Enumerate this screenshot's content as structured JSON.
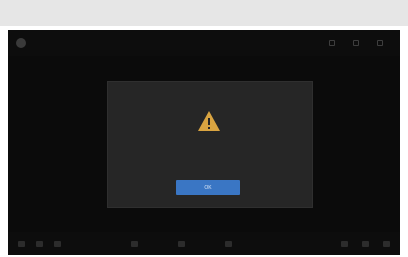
{
  "app": {
    "title": "",
    "top_actions": [
      {
        "icon": "caption-icon",
        "label": ""
      },
      {
        "icon": "settings-icon",
        "label": ""
      },
      {
        "icon": "fullscreen-icon",
        "label": ""
      }
    ]
  },
  "dialog": {
    "icon": "warning-icon",
    "title": "",
    "message": "",
    "ok_label": "OK"
  },
  "colors": {
    "background": "#0d0d0d",
    "dialog": "#262626",
    "accent": "#3a76c4",
    "warning": "#d9a441"
  }
}
